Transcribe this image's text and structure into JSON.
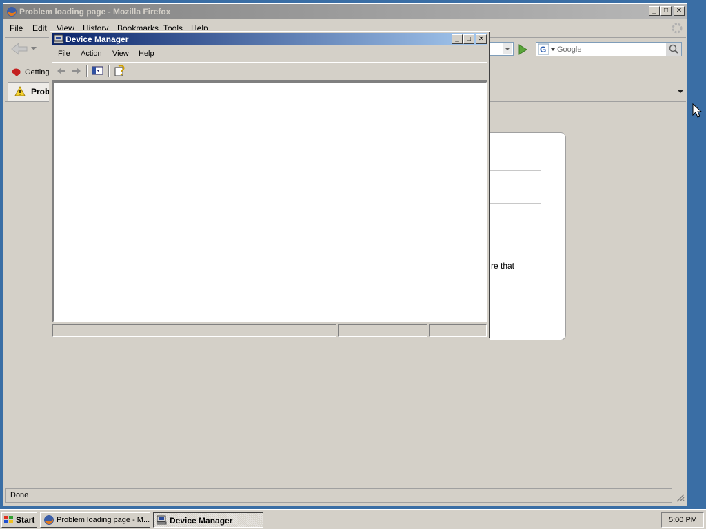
{
  "firefox": {
    "title": "Problem loading page - Mozilla Firefox",
    "menu": [
      "File",
      "Edit",
      "View",
      "History",
      "Bookmarks",
      "Tools",
      "Help"
    ],
    "bookmark_label": "Getting",
    "tab_label": "Proble",
    "search_placeholder": "Google",
    "page_fragment_text": "re that",
    "status_text": "Done"
  },
  "device_manager": {
    "title": "Device Manager",
    "menu": [
      "File",
      "Action",
      "View",
      "Help"
    ]
  },
  "taskbar": {
    "start_label": "Start",
    "tasks": [
      "Problem loading page - M...",
      "Device Manager"
    ],
    "clock": "5:00 PM"
  }
}
